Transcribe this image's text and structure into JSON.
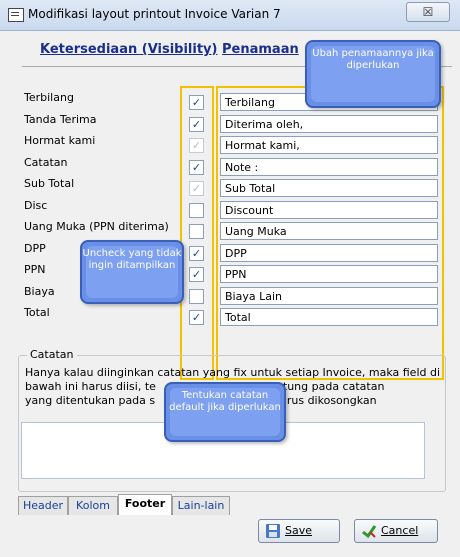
{
  "window": {
    "title": "Modifikasi layout printout Invoice Varian 7",
    "close_label": "☒"
  },
  "header_links": {
    "visibility": "Ketersediaan (Visibility)",
    "naming": "Penamaan"
  },
  "rows": [
    {
      "label": "Terbilang",
      "checked": true,
      "enabled": true,
      "name": "Terbilang"
    },
    {
      "label": "Tanda Terima",
      "checked": true,
      "enabled": true,
      "name": "Diterima oleh,"
    },
    {
      "label": "Hormat kami",
      "checked": true,
      "enabled": false,
      "name": "Hormat kami,"
    },
    {
      "label": "Catatan",
      "checked": true,
      "enabled": true,
      "name": "Note :"
    },
    {
      "label": "Sub Total",
      "checked": true,
      "enabled": false,
      "name": "Sub Total"
    },
    {
      "label": "Disc",
      "checked": false,
      "enabled": true,
      "name": "Discount"
    },
    {
      "label": "Uang Muka (PPN diterima)",
      "checked": false,
      "enabled": true,
      "name": "Uang Muka"
    },
    {
      "label": "DPP",
      "checked": true,
      "enabled": true,
      "name": "DPP"
    },
    {
      "label": "PPN",
      "checked": true,
      "enabled": true,
      "name": "PPN"
    },
    {
      "label": "Biaya",
      "checked": false,
      "enabled": true,
      "name": "Biaya Lain"
    },
    {
      "label": "Total",
      "checked": true,
      "enabled": true,
      "name": "Total"
    }
  ],
  "catatan": {
    "legend": "Catatan",
    "desc_line1": "Hanya kalau diinginkan catatan yang fix untuk setiap Invoice, maka field di",
    "desc_line2": "bawah ini harus diisi, te",
    "desc_line2b": "ntung pada catatan",
    "desc_line3": "yang ditentukan pada s",
    "desc_line3b": "harus dikosongkan",
    "memo_value": ""
  },
  "tabs": [
    "Header",
    "Kolom",
    "Footer",
    "Lain-lain"
  ],
  "active_tab": "Footer",
  "buttons": {
    "save": "Save",
    "cancel": "Cancel"
  },
  "callouts": {
    "naming": "Ubah penamaannya jika diperlukan",
    "uncheck": "Uncheck yang tidak ingin ditampilkan",
    "note": "Tentukan catatan default jika diperlukan"
  },
  "colors": {
    "highlight": "#f2c200",
    "callout": "#6a8fe6",
    "link": "#1a2f8c"
  }
}
